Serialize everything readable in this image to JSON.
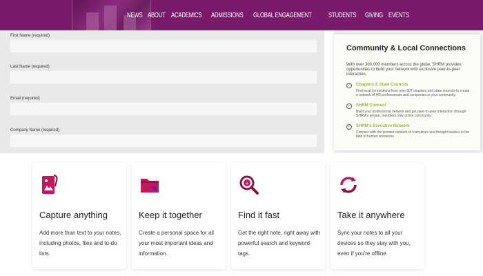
{
  "nav": {
    "items": [
      "NEWS",
      "ABOUT",
      "ACADEMICS",
      "ADMISSIONS",
      "GLOBAL ENGAGEMENT",
      "STUDENTS",
      "GIVING",
      "EVENTS"
    ]
  },
  "form": {
    "first_name_label": "First Name (required)",
    "last_name_label": "Last Name (required)",
    "email_label": "Email (required)",
    "company_label": "Company Name (required)"
  },
  "card": {
    "title": "Community & Local Connections",
    "intro": "With over 300,000 members across the globe, SHRM provides opportunities to build your network with exclusive peer-to-peer interaction.",
    "items": [
      {
        "title": "Chapters & State Councils",
        "desc": "Find local connections from over 607 chapters and state councils to create a network of HR professionals and companies in your community."
      },
      {
        "title": "SHRM Connect",
        "desc": "Build your professional network and get peer-to-peer interaction through SHRM's private, members only online community."
      },
      {
        "title": "SHRM's Executive Network",
        "desc": "Connect with the premier network of executives and thought leaders in the field of human resources."
      }
    ]
  },
  "features": [
    {
      "icon": "capture-note-icon",
      "title": "Capture anything",
      "desc": "Add more than text to your notes, including photos, files and to-do lists."
    },
    {
      "icon": "folder-icon",
      "title": "Keep it together",
      "desc": "Create a personal space for all your most important ideas and information."
    },
    {
      "icon": "search-icon",
      "title": "Find it fast",
      "desc": "Get the right note, right away with powerful search and keyword tags."
    },
    {
      "icon": "sync-icon",
      "title": "Take it anywhere",
      "desc": "Sync your notes to all your devices so they stay with you, even if you're offline."
    }
  ],
  "colors": {
    "brand_purple": "#7a1a6b",
    "accent_green": "#9ab72a",
    "icon_pink": "#c2185b"
  }
}
